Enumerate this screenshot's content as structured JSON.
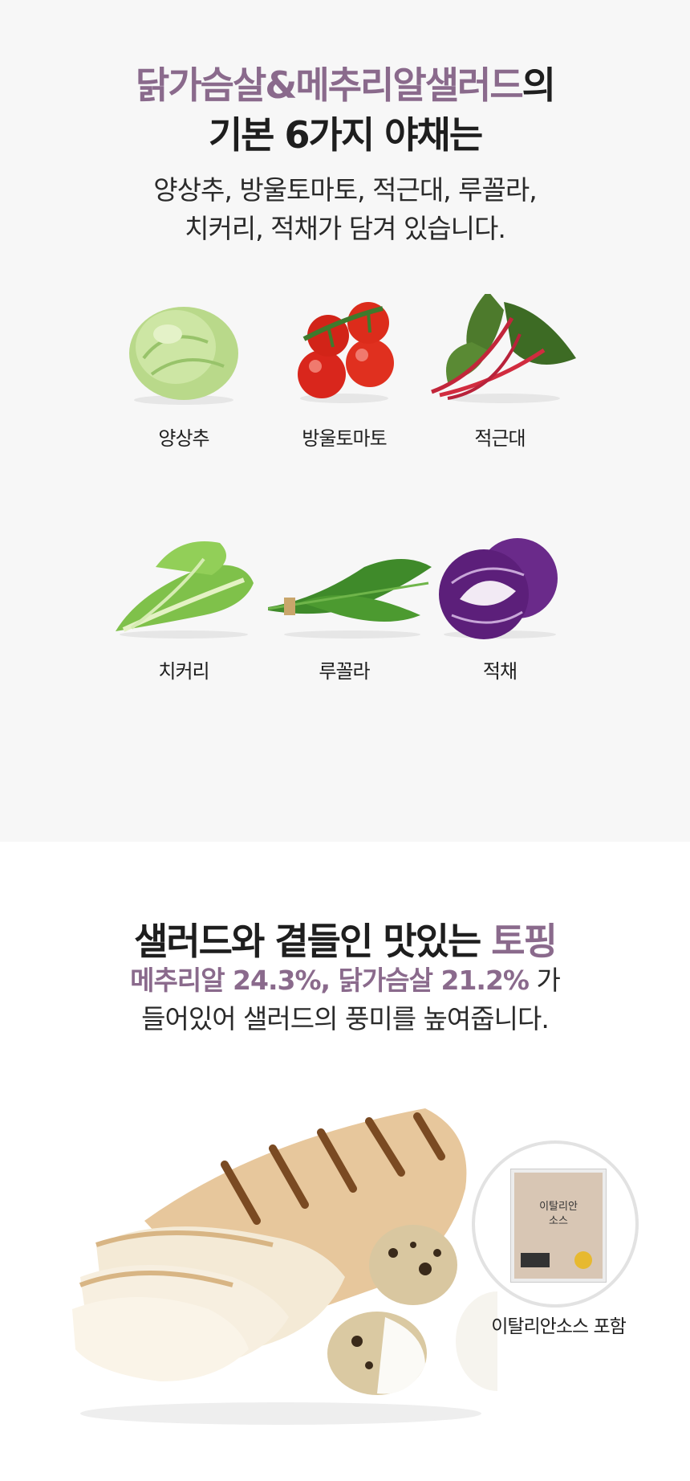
{
  "section1": {
    "title_highlight": "닭가슴살&메추리알샐러드",
    "title_suffix": "의",
    "title_line2": "기본 6가지 야채는",
    "desc_line1": "양상추, 방울토마토, 적근대, 루꼴라,",
    "desc_line2": "치커리, 적채가 담겨 있습니다.",
    "vegetables": [
      {
        "label": "양상추",
        "icon": "lettuce-icon"
      },
      {
        "label": "방울토마토",
        "icon": "cherry-tomato-icon"
      },
      {
        "label": "적근대",
        "icon": "red-chard-icon"
      },
      {
        "label": "치커리",
        "icon": "chicory-icon"
      },
      {
        "label": "루꼴라",
        "icon": "arugula-icon"
      },
      {
        "label": "적채",
        "icon": "red-cabbage-icon"
      }
    ]
  },
  "section2": {
    "title_main": "샐러드와 곁들인 맛있는",
    "title_highlight": "토핑",
    "line1_highlight": "메추리알 24.3%, 닭가슴살 21.2%",
    "line1_suffix": "가",
    "line2": "들어있어 샐러드의 풍미를 높여줍니다.",
    "sauce_pack_text_line1": "이탈리안",
    "sauce_pack_text_line2": "소스",
    "sauce_caption": "이탈리안소스 포함"
  },
  "colors": {
    "accent": "#8a6a8c",
    "top_background": "#f7f7f7",
    "bottom_background": "#ffffff"
  }
}
